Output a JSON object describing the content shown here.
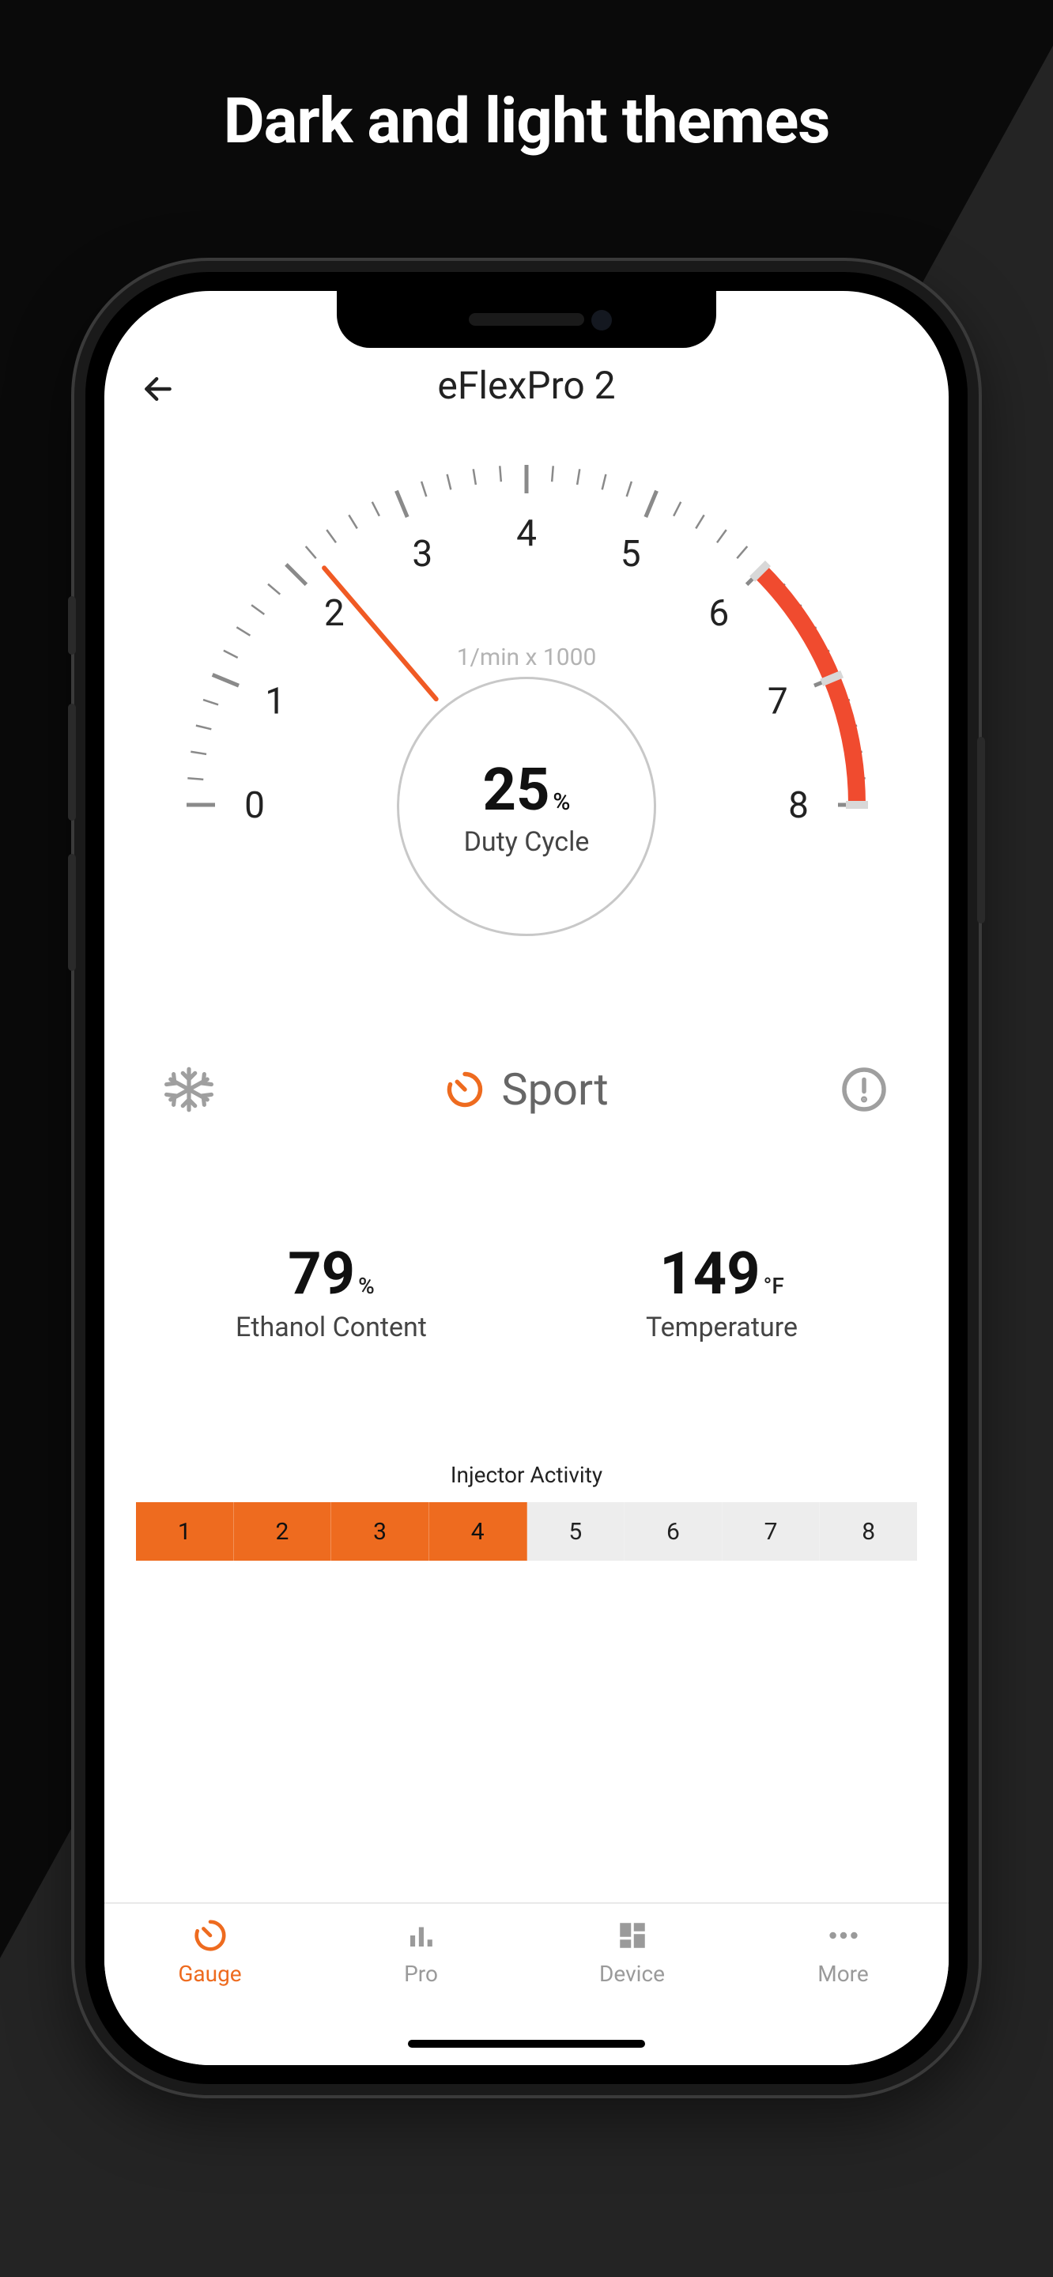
{
  "promo": {
    "title": "Dark and light themes"
  },
  "header": {
    "title": "eFlexPro 2"
  },
  "gauge": {
    "multiplier_label": "1/min x 1000",
    "duty_value": "25",
    "duty_unit": "%",
    "duty_label": "Duty Cycle",
    "ticks": [
      "0",
      "1",
      "2",
      "3",
      "4",
      "5",
      "6",
      "7",
      "8"
    ],
    "needle_value": 2.2,
    "redline_start": 6,
    "max": 8
  },
  "mode": {
    "label": "Sport"
  },
  "stats": {
    "ethanol": {
      "value": "79",
      "unit": "%",
      "label": "Ethanol Content"
    },
    "temperature": {
      "value": "149",
      "unit": "°F",
      "label": "Temperature"
    }
  },
  "injector": {
    "title": "Injector Activity",
    "cells": [
      "1",
      "2",
      "3",
      "4",
      "5",
      "6",
      "7",
      "8"
    ],
    "active_count": 4
  },
  "tabs": [
    {
      "label": "Gauge",
      "icon": "gauge-icon",
      "active": true
    },
    {
      "label": "Pro",
      "icon": "bars-icon",
      "active": false
    },
    {
      "label": "Device",
      "icon": "grid-icon",
      "active": false
    },
    {
      "label": "More",
      "icon": "more-icon",
      "active": false
    }
  ],
  "colors": {
    "accent": "#ee6b1f",
    "muted": "#9a9a9a"
  }
}
